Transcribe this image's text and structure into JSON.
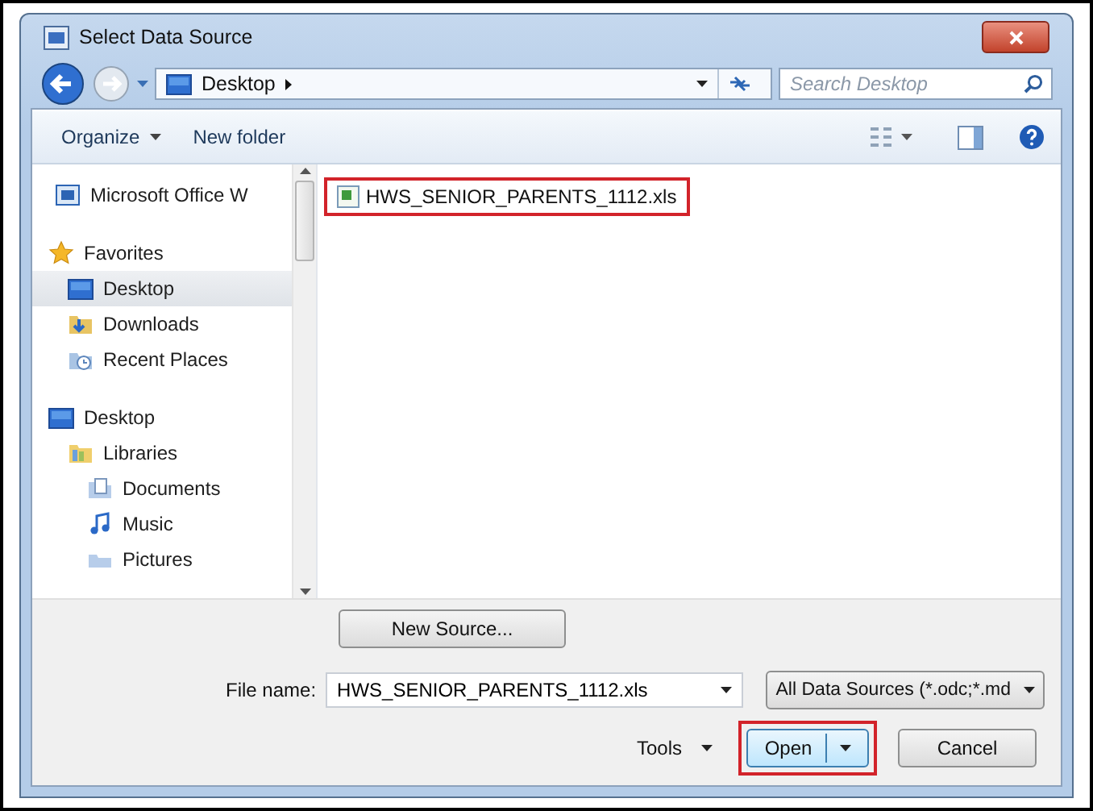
{
  "window": {
    "title": "Select Data Source"
  },
  "address": {
    "path": "Desktop",
    "search_placeholder": "Search Desktop"
  },
  "toolbar": {
    "items": [
      {
        "label": "Organize",
        "dropdown": true
      },
      {
        "label": "New folder",
        "dropdown": false
      }
    ]
  },
  "navigation": {
    "items": [
      {
        "label": "Microsoft Office W",
        "selected": false
      },
      {
        "label": "Favorites",
        "selected": false,
        "children": [
          {
            "label": "Desktop",
            "selected": true
          },
          {
            "label": "Downloads",
            "selected": false
          },
          {
            "label": "Recent Places",
            "selected": false
          }
        ]
      },
      {
        "label": "Desktop",
        "selected": false,
        "children": [
          {
            "label": "Libraries",
            "selected": false,
            "children": [
              {
                "label": "Documents",
                "selected": false
              },
              {
                "label": "Music",
                "selected": false
              },
              {
                "label": "Pictures",
                "selected": false
              }
            ]
          }
        ]
      }
    ]
  },
  "files": [
    {
      "name": "HWS_SENIOR_PARENTS_1112.xls",
      "highlighted": true
    }
  ],
  "new_source_button": "New Source...",
  "file_name": {
    "label": "File name:",
    "value": "HWS_SENIOR_PARENTS_1112.xls"
  },
  "file_type": "All Data Sources (*.odc;*.md",
  "tools": "Tools",
  "buttons": [
    {
      "label": "Open",
      "kind": "split",
      "highlighted": true
    },
    {
      "label": "Cancel",
      "kind": "plain",
      "highlighted": false
    }
  ]
}
